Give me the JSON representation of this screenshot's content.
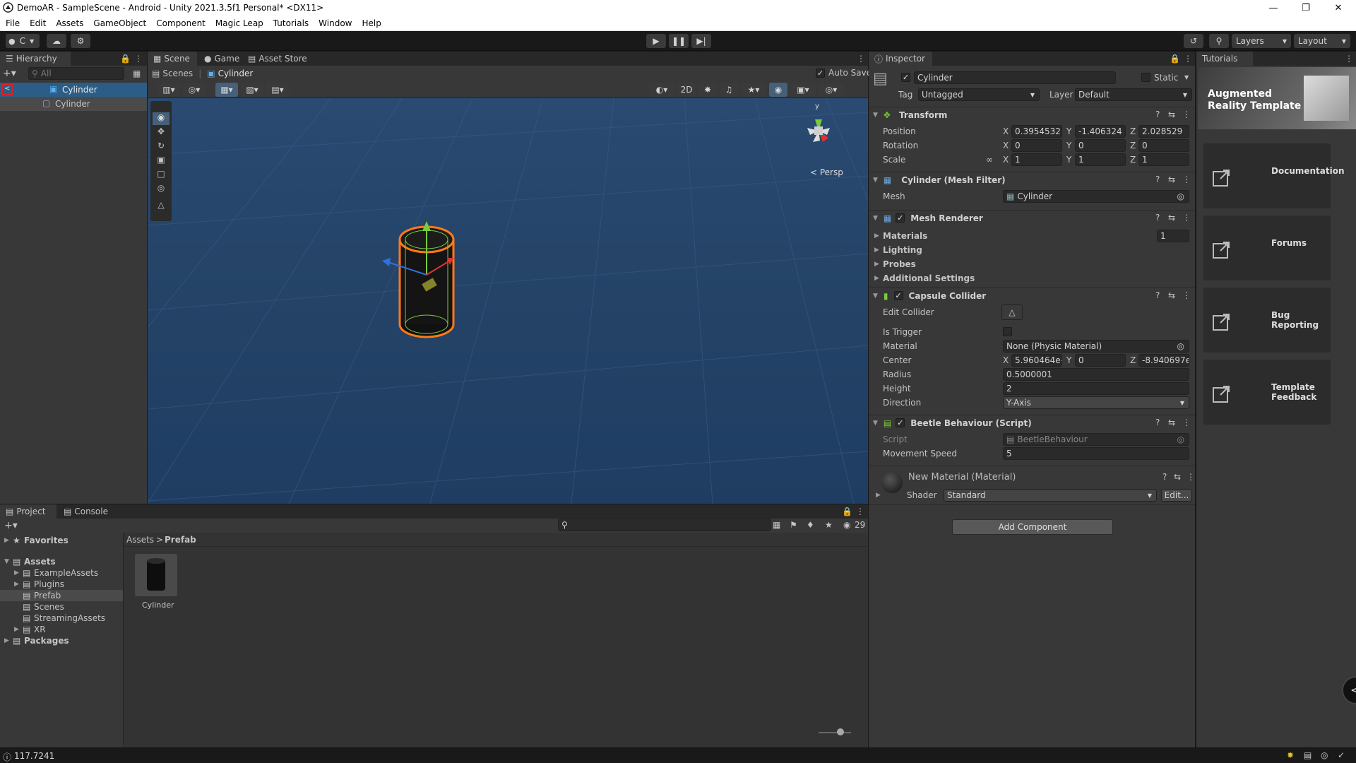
{
  "window": {
    "title": "DemoAR - SampleScene - Android - Unity 2021.3.5f1 Personal* <DX11>"
  },
  "menu": [
    "File",
    "Edit",
    "Assets",
    "GameObject",
    "Component",
    "Magic Leap",
    "Tutorials",
    "Window",
    "Help"
  ],
  "toolbar": {
    "account_label": "C",
    "layers_label": "Layers",
    "layout_label": "Layout"
  },
  "hierarchy": {
    "tab": "Hierarchy",
    "search_placeholder": "All",
    "root": "Cylinder",
    "child": "Cylinder"
  },
  "scene": {
    "tabs": [
      "Scene",
      "Game",
      "Asset Store"
    ],
    "breadcrumb_root": "Scenes",
    "breadcrumb_item": "Cylinder",
    "auto_save": "Auto Save",
    "mode_2d": "2D",
    "persp_label": "< Persp",
    "gizmo_y": "y"
  },
  "inspector": {
    "tab": "Inspector",
    "object_name": "Cylinder",
    "static_label": "Static",
    "tag_label": "Tag",
    "tag_value": "Untagged",
    "layer_label": "Layer",
    "layer_value": "Default",
    "transform": {
      "title": "Transform",
      "position_label": "Position",
      "rotation_label": "Rotation",
      "scale_label": "Scale",
      "position": [
        "0.3954532",
        "-1.406324",
        "2.028529"
      ],
      "rotation": [
        "0",
        "0",
        "0"
      ],
      "scale": [
        "1",
        "1",
        "1"
      ]
    },
    "mesh_filter": {
      "title": "Cylinder (Mesh Filter)",
      "mesh_label": "Mesh",
      "mesh_value": "Cylinder"
    },
    "mesh_renderer": {
      "title": "Mesh Renderer",
      "materials_label": "Materials",
      "materials_count": "1",
      "lighting": "Lighting",
      "probes": "Probes",
      "additional": "Additional Settings"
    },
    "capsule": {
      "title": "Capsule Collider",
      "edit_collider": "Edit Collider",
      "is_trigger": "Is Trigger",
      "material_label": "Material",
      "material_value": "None (Physic Material)",
      "center_label": "Center",
      "center": [
        "5.960464e-",
        "0",
        "-8.940697e"
      ],
      "radius_label": "Radius",
      "radius": "0.5000001",
      "height_label": "Height",
      "height": "2",
      "direction_label": "Direction",
      "direction": "Y-Axis"
    },
    "script": {
      "title": "Beetle Behaviour (Script)",
      "script_label": "Script",
      "script_value": "BeetleBehaviour",
      "speed_label": "Movement Speed",
      "speed": "5"
    },
    "material": {
      "title": "New Material (Material)",
      "shader_label": "Shader",
      "shader_value": "Standard",
      "edit": "Edit..."
    },
    "add_component": "Add Component"
  },
  "tutorials": {
    "tab": "Tutorials",
    "banner": "Augmented Reality Template",
    "items": [
      "Documentation",
      "Forums",
      "Bug Reporting",
      "Template Feedback"
    ]
  },
  "project": {
    "tabs": [
      "Project",
      "Console"
    ],
    "hidden_count": "29",
    "favorites": "Favorites",
    "assets": "Assets",
    "folders": [
      "ExampleAssets",
      "Plugins",
      "Prefab",
      "Scenes",
      "StreamingAssets",
      "XR"
    ],
    "packages": "Packages",
    "breadcrumb_root": "Assets",
    "breadcrumb_leaf": "Prefab",
    "asset_name": "Cylinder"
  },
  "status": {
    "value": "117.7241"
  },
  "colors": {
    "scene_bg": "#26456b",
    "selection_outline": "#ff7a1a",
    "panel": "#383838"
  }
}
